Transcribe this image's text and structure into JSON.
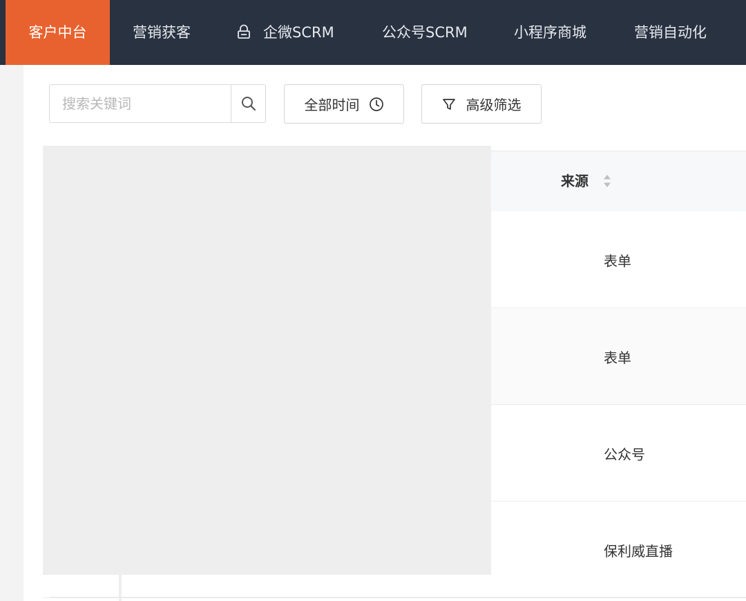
{
  "nav": {
    "items": [
      {
        "label": "客户中台",
        "active": true
      },
      {
        "label": "营销获客"
      },
      {
        "label": "企微SCRM",
        "icon": "lock-icon"
      },
      {
        "label": "公众号SCRM"
      },
      {
        "label": "小程序商城"
      },
      {
        "label": "营销自动化"
      }
    ]
  },
  "toolbar": {
    "search_placeholder": "搜索关键词",
    "search_icon": "search-icon",
    "time_filter_label": "全部时间",
    "time_filter_icon": "clock-icon",
    "advanced_filter_label": "高级筛选",
    "advanced_filter_icon": "filter-icon"
  },
  "table": {
    "columns": [
      {
        "label": "来源",
        "sortable": true
      }
    ],
    "rows": [
      {
        "source": "表单"
      },
      {
        "source": "表单"
      },
      {
        "source": "公众号"
      },
      {
        "source": "保利威直播"
      }
    ]
  },
  "colors": {
    "nav_bg": "#293241",
    "nav_active": "#e8622f",
    "text": "#333333"
  }
}
